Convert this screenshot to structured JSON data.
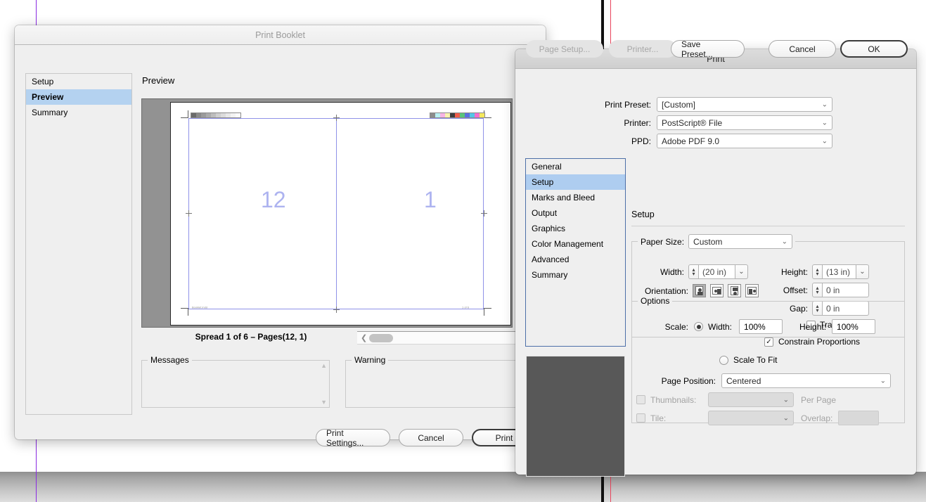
{
  "desktop": {
    "guides": [
      "purple-guide",
      "black-guide",
      "red-guide"
    ]
  },
  "print_booklet": {
    "title": "Print Booklet",
    "nav": [
      {
        "label": "Setup",
        "selected": false
      },
      {
        "label": "Preview",
        "selected": true
      },
      {
        "label": "Summary",
        "selected": false
      }
    ],
    "preview_heading": "Preview",
    "preview": {
      "left_page": "12",
      "right_page": "1",
      "tiny_left": "Booklet.indd",
      "tiny_right": "1 of 6"
    },
    "spread_label": "Spread 1 of 6 – Pages(12, 1)",
    "messages_legend": "Messages",
    "messages_text": "",
    "warning_legend": "Warning",
    "warning_text": "",
    "buttons": {
      "print_settings": "Print Settings...",
      "cancel": "Cancel",
      "print": "Print"
    }
  },
  "print_dialog": {
    "title": "Print",
    "top_fields": [
      {
        "label": "Print Preset:",
        "value": "[Custom]"
      },
      {
        "label": "Printer:",
        "value": "PostScript® File"
      },
      {
        "label": "PPD:",
        "value": "Adobe PDF 9.0"
      }
    ],
    "tabs": [
      {
        "label": "General",
        "selected": false
      },
      {
        "label": "Setup",
        "selected": true
      },
      {
        "label": "Marks and Bleed",
        "selected": false
      },
      {
        "label": "Output",
        "selected": false
      },
      {
        "label": "Graphics",
        "selected": false
      },
      {
        "label": "Color Management",
        "selected": false
      },
      {
        "label": "Advanced",
        "selected": false
      },
      {
        "label": "Summary",
        "selected": false
      }
    ],
    "panel_title": "Setup",
    "paper_size": {
      "label": "Paper Size:",
      "value": "Custom",
      "width_label": "Width:",
      "width_value": "(20 in)",
      "height_label": "Height:",
      "height_value": "(13 in)",
      "offset_label": "Offset:",
      "offset_value": "0 in",
      "gap_label": "Gap:",
      "gap_value": "0 in",
      "transverse_label": "Transverse",
      "transverse_checked": false,
      "orientation_label": "Orientation:",
      "orientation_selected": 0,
      "orientation_options": [
        "portrait",
        "landscape-left",
        "portrait-flipped",
        "landscape-right"
      ]
    },
    "options": {
      "legend": "Options",
      "scale_label": "Scale:",
      "scale_mode": "width-height",
      "width_label": "Width:",
      "width_value": "100%",
      "height_label": "Height:",
      "height_value": "100%",
      "constrain_label": "Constrain Proportions",
      "constrain_checked": true,
      "scale_to_fit_label": "Scale To Fit",
      "scale_to_fit_selected": false,
      "page_position_label": "Page Position:",
      "page_position_value": "Centered",
      "thumbnails_label": "Thumbnails:",
      "thumbnails_checked": false,
      "thumbnails_value": "",
      "per_page_label": "Per Page",
      "tile_label": "Tile:",
      "tile_checked": false,
      "tile_value": "",
      "overlap_label": "Overlap:",
      "overlap_value": ""
    },
    "buttons": {
      "page_setup": "Page Setup...",
      "printer": "Printer...",
      "save_preset": "Save Preset...",
      "cancel": "Cancel",
      "ok": "OK"
    }
  },
  "colors": {
    "selection_blue": "#b4d2f0",
    "tab_selection_blue": "#aecdf0",
    "guide_purple": "#8a2be2",
    "guide_red": "#e8455c",
    "spread_blue": "#8f92e8",
    "page_number": "#adb3f0",
    "preview_bg": "#929292",
    "thumb_bg": "#585858"
  }
}
